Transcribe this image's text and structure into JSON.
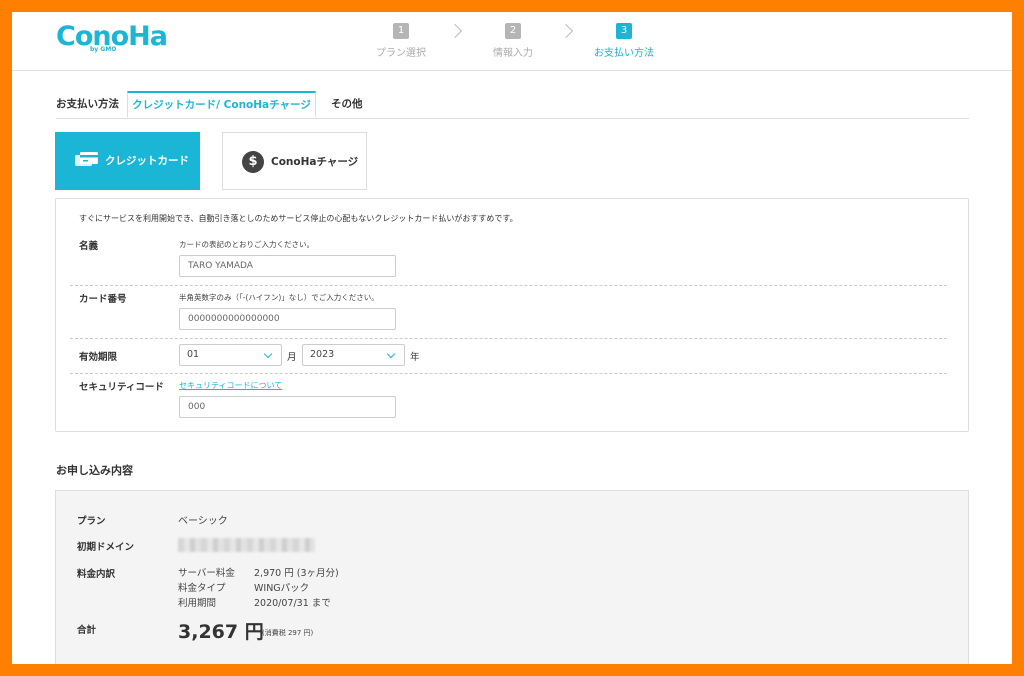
{
  "brand": {
    "logo": "ConoHa",
    "logo_sub": "by GMO",
    "accent": "#1bb5d6",
    "frame_color": "#ff7f00"
  },
  "steps": [
    {
      "num": "1",
      "label": "プラン選択"
    },
    {
      "num": "2",
      "label": "情報入力"
    },
    {
      "num": "3",
      "label": "お支払い方法"
    }
  ],
  "tabs": {
    "heading": "お支払い方法",
    "items": [
      {
        "label": "クレジットカード/ ConoHaチャージ"
      },
      {
        "label": "その他"
      }
    ]
  },
  "methods": {
    "card": {
      "label": "クレジットカード",
      "icon": "credit-card-icon"
    },
    "charge": {
      "label": "ConoHaチャージ",
      "icon": "dollar-icon",
      "glyph": "$"
    }
  },
  "form": {
    "intro": "すぐにサービスを利用開始でき、自動引き落としのためサービス停止の心配もないクレジットカード払いがおすすめです。",
    "name": {
      "label": "名義",
      "hint": "カードの表記のとおりご入力ください。",
      "value": "TARO YAMADA"
    },
    "number": {
      "label": "カード番号",
      "hint": "半角英数字のみ（「-(ハイフン)」なし）でご入力ください。",
      "value": "0000000000000000"
    },
    "expiry": {
      "label": "有効期限",
      "month": "01",
      "month_unit": "月",
      "year": "2023",
      "year_unit": "年"
    },
    "security": {
      "label": "セキュリティコード",
      "link": "セキュリティコードについて",
      "value": "000"
    }
  },
  "summary": {
    "title": "お申し込み内容",
    "plan": {
      "label": "プラン",
      "value": "ベーシック"
    },
    "domain": {
      "label": "初期ドメイン"
    },
    "breakdown": {
      "label": "料金内訳",
      "rows": [
        {
          "key": "サーバー料金",
          "value": "2,970 円 (3ヶ月分)"
        },
        {
          "key": "料金タイプ",
          "value": "WINGパック"
        },
        {
          "key": "利用期間",
          "value": "2020/07/31 まで"
        }
      ]
    },
    "total": {
      "label": "合計",
      "value": "3,267 円",
      "tax": "(消費税 297 円)"
    }
  }
}
